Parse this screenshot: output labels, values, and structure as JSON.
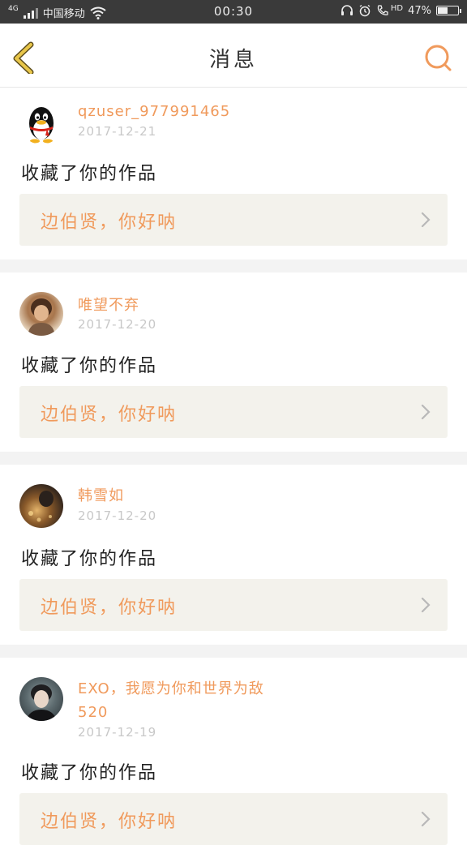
{
  "status_bar": {
    "network": "4G",
    "carrier": "中国移动",
    "time": "00:30",
    "hd": "HD",
    "battery_percent": "47%",
    "battery_level": 0.47,
    "icons": [
      "signal-icon",
      "wifi-icon",
      "headset-icon",
      "alarm-icon",
      "call-icon",
      "battery-icon"
    ]
  },
  "header": {
    "title": "消息",
    "back_icon": "chevron-left-icon",
    "search_icon": "search-icon"
  },
  "colors": {
    "accent": "#f09a5c",
    "back_icon": "#e8c64a",
    "quote_bg": "#f3f2ec",
    "divider": "#f3f3f3",
    "date": "#c8c8c8"
  },
  "messages": [
    {
      "avatar": "qq-penguin-avatar",
      "user": "qzuser_977991465",
      "date": "2017-12-21",
      "action": "收藏了你的作品",
      "quote": "边伯贤，你好呐"
    },
    {
      "avatar": "user-photo-avatar",
      "user": "唯望不弃",
      "date": "2017-12-20",
      "action": "收藏了你的作品",
      "quote": "边伯贤，你好呐"
    },
    {
      "avatar": "user-photo-avatar",
      "user": "韩雪如",
      "date": "2017-12-20",
      "action": "收藏了你的作品",
      "quote": "边伯贤，你好呐"
    },
    {
      "avatar": "user-photo-avatar",
      "user": "EXO，我愿为你和世界为敌520",
      "date": "2017-12-19",
      "action": "收藏了你的作品",
      "quote": "边伯贤，你好呐"
    }
  ]
}
